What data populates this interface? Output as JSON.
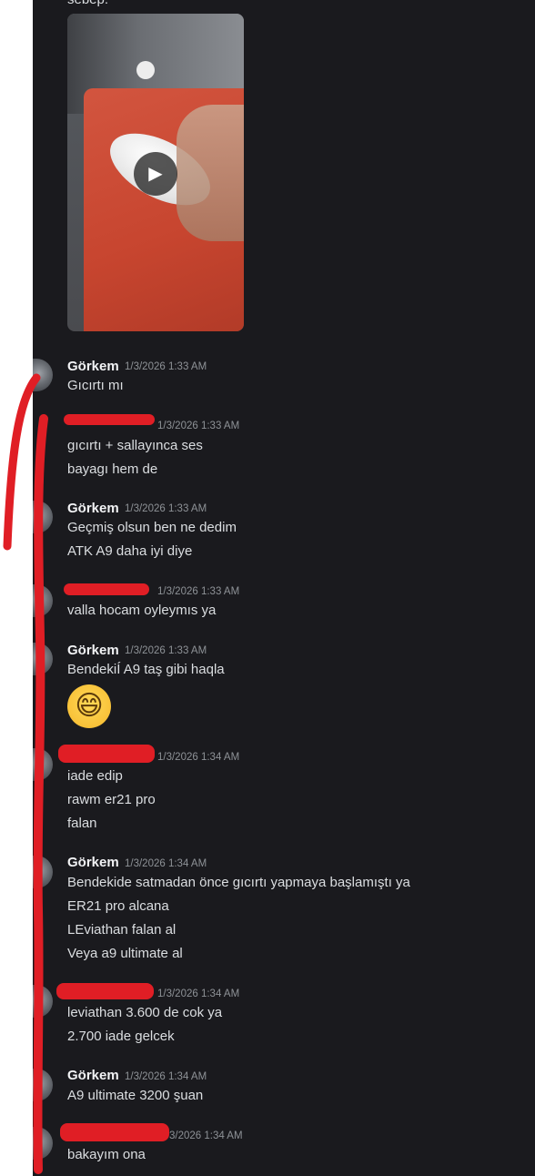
{
  "top_message": {
    "partial_text": "sebep:",
    "video": {
      "play_icon": "play-icon"
    }
  },
  "messages": [
    {
      "author": "Görkem",
      "timestamp": "1/3/2026 1:33 AM",
      "lines": [
        "Gıcırtı mı"
      ]
    },
    {
      "author": "",
      "timestamp": "1/3/2026 1:33 AM",
      "lines": [
        "gıcırtı + sallayınca ses",
        "bayagı hem de"
      ]
    },
    {
      "author": "Görkem",
      "timestamp": "1/3/2026 1:33 AM",
      "lines": [
        "Geçmiş olsun ben ne dedim",
        "ATK A9 daha iyi diye"
      ]
    },
    {
      "author": "",
      "timestamp": "1/3/2026 1:33 AM",
      "lines": [
        "valla hocam oyleymıs ya"
      ]
    },
    {
      "author": "Görkem",
      "timestamp": "1/3/2026 1:33 AM",
      "lines": [
        "BendekiÍ A9 taş gibi haqla"
      ],
      "emoji": "😄"
    },
    {
      "author": "",
      "timestamp": "1/3/2026 1:34 AM",
      "lines": [
        "iade edip",
        "rawm er21 pro",
        "falan"
      ]
    },
    {
      "author": "Görkem",
      "timestamp": "1/3/2026 1:34 AM",
      "lines": [
        "Bendekide satmadan önce gıcırtı yapmaya başlamıştı ya",
        "ER21 pro alcana",
        "LEviathan falan al",
        "Veya a9 ultimate al"
      ]
    },
    {
      "author": "",
      "timestamp": "1/3/2026 1:34 AM",
      "lines": [
        "leviathan 3.600 de cok ya",
        "2.700 iade gelcek"
      ]
    },
    {
      "author": "Görkem",
      "timestamp": "1/3/2026 1:34 AM",
      "lines": [
        "A9 ultimate 3200 şuan"
      ]
    },
    {
      "author": "",
      "timestamp": "3/2026 1:34 AM",
      "lines": [
        "bakayım ona"
      ]
    }
  ],
  "colors": {
    "background": "#1a1a1e",
    "text": "#dbdee1",
    "author": "#f2f3f5",
    "timestamp": "#8e9297",
    "annotation_red": "#e01e25"
  }
}
